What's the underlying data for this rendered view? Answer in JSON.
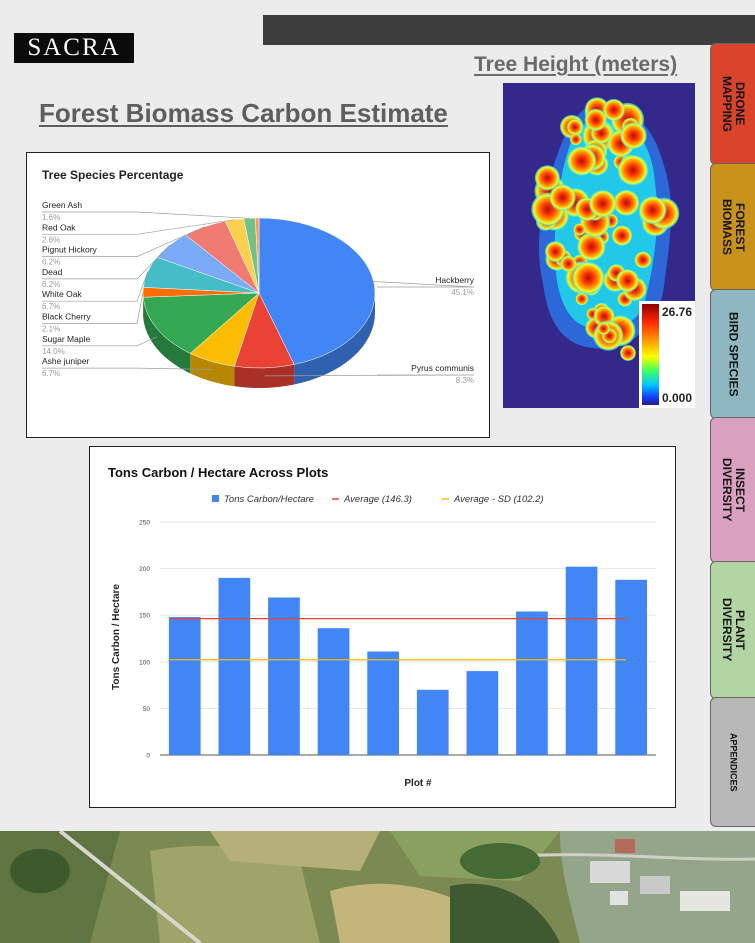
{
  "header": {
    "logo": "SACRA"
  },
  "page": {
    "title": "Forest Biomass Carbon Estimate"
  },
  "map": {
    "title": "Tree Height (meters)",
    "scale_max": "26.76",
    "scale_min": "0.000",
    "colors": [
      "#8b0000",
      "#ff2a00",
      "#ffa500",
      "#ffff00",
      "#40ff60",
      "#00c8ff",
      "#1040ff",
      "#2a1a8a"
    ]
  },
  "tabs": [
    {
      "label": "DRONE\nMAPPING",
      "color": "#d9442b"
    },
    {
      "label": "FOREST\nBIOMASS",
      "color": "#c8921b"
    },
    {
      "label": "BIRD SPECIES",
      "color": "#8fb7c1"
    },
    {
      "label": "INSECT\nDIVERSITY",
      "color": "#d9a1bf"
    },
    {
      "label": "PLANT\nDIVERSITY",
      "color": "#b2d5a4"
    },
    {
      "label": "APPENDICES",
      "color": "#b8b8b8"
    }
  ],
  "chart_data": [
    {
      "type": "pie",
      "title": "Tree Species Percentage",
      "slices": [
        {
          "label": "Hackberry",
          "value": 45.1,
          "pct": "45.1%",
          "color": "#4285f4"
        },
        {
          "label": "Pyrus communis",
          "value": 8.3,
          "pct": "8.3%",
          "color": "#ea4335"
        },
        {
          "label": "Ashe juniper",
          "value": 6.7,
          "pct": "6.7%",
          "color": "#fbbc04"
        },
        {
          "label": "Sugar Maple",
          "value": 14.0,
          "pct": "14.0%",
          "color": "#34a853"
        },
        {
          "label": "Black Cherry",
          "value": 2.1,
          "pct": "2.1%",
          "color": "#ff6d01"
        },
        {
          "label": "White Oak",
          "value": 6.7,
          "pct": "6.7%",
          "color": "#46bdc6"
        },
        {
          "label": "Dead",
          "value": 6.2,
          "pct": "6.2%",
          "color": "#7baaf7"
        },
        {
          "label": "Pignut Hickory",
          "value": 6.2,
          "pct": "6.2%",
          "color": "#f07b72"
        },
        {
          "label": "Red Oak",
          "value": 2.6,
          "pct": "2.6%",
          "color": "#fcd04f"
        },
        {
          "label": "Green Ash",
          "value": 1.6,
          "pct": "1.6%",
          "color": "#71c287"
        },
        {
          "label": "",
          "value": 0.5,
          "pct": "",
          "color": "#ff994d"
        }
      ]
    },
    {
      "type": "bar",
      "title": "Tons Carbon / Hectare Across Plots",
      "xlabel": "Plot #",
      "ylabel": "Tons Carbon / Hectare",
      "ylim": [
        0,
        250
      ],
      "yticks": [
        "0",
        "50",
        "100",
        "150",
        "200",
        "250"
      ],
      "series": [
        {
          "name": "Tons Carbon/Hectare",
          "color": "#4285f4",
          "values": [
            148,
            190,
            169,
            136,
            111,
            70,
            90,
            154,
            202,
            188
          ]
        }
      ],
      "lines": [
        {
          "name": "Average (146.3)",
          "value": 146.3,
          "color": "#ea4335"
        },
        {
          "name": "Average - SD (102.2)",
          "value": 102.2,
          "color": "#fbbc04"
        }
      ]
    }
  ]
}
